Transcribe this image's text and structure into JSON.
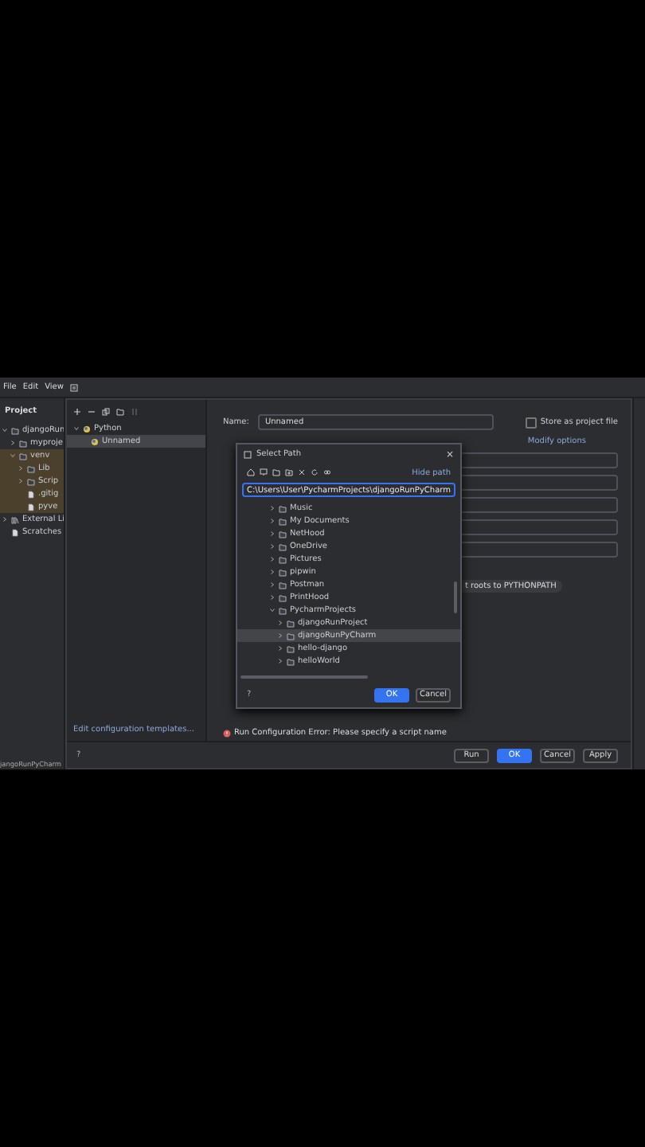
{
  "menu": [
    "File",
    "Edit",
    "View"
  ],
  "project": {
    "title": "Project",
    "tree": [
      {
        "label": "djangoRun",
        "expanded": true,
        "highlighted": false,
        "children": [
          {
            "label": "myproje",
            "expanded": false,
            "highlighted": false
          },
          {
            "label": "venv",
            "expanded": true,
            "highlighted": true,
            "children": [
              {
                "label": "Lib",
                "expanded": false,
                "highlighted": true
              },
              {
                "label": "Scrip",
                "expanded": false,
                "highlighted": true
              },
              {
                "label": ".gitig",
                "kind": "file",
                "highlighted": true
              },
              {
                "label": "pyve",
                "kind": "file",
                "highlighted": true
              }
            ]
          }
        ]
      },
      {
        "label": "External Li",
        "kind": "library",
        "expanded": false,
        "highlighted": false
      },
      {
        "label": "Scratches",
        "kind": "file",
        "highlighted": false
      }
    ]
  },
  "status_bar": {
    "text": "jangoRunPyCharm"
  },
  "run_config": {
    "tree": [
      {
        "label": "Python",
        "expanded": true,
        "selected": false,
        "children": [
          {
            "label": "Unnamed",
            "selected": true
          }
        ]
      }
    ],
    "help": "?",
    "templates_link": "Edit configuration templates...",
    "name_label": "Name:",
    "name_value": "Unnamed",
    "store_label": "Store as project file",
    "store_checked": false,
    "modify_options": "Modify options",
    "chip": "t roots to PYTHONPATH",
    "error": "Run Configuration Error: Please specify a script name",
    "buttons": [
      {
        "label": "Run",
        "primary": false
      },
      {
        "label": "OK",
        "primary": true
      },
      {
        "label": "Cancel",
        "primary": false
      },
      {
        "label": "Apply",
        "primary": false
      }
    ]
  },
  "select_path": {
    "title": "Select Path",
    "close": "×",
    "help": "?",
    "hide_path": "Hide path",
    "path": "C:\\Users\\User\\PycharmProjects\\djangoRunPyCharm",
    "tree": [
      {
        "label": "Music",
        "expanded": false,
        "selected": false
      },
      {
        "label": "My Documents",
        "expanded": false,
        "selected": false
      },
      {
        "label": "NetHood",
        "expanded": false,
        "selected": false
      },
      {
        "label": "OneDrive",
        "expanded": false,
        "selected": false
      },
      {
        "label": "Pictures",
        "expanded": false,
        "selected": false
      },
      {
        "label": "pipwin",
        "expanded": false,
        "selected": false
      },
      {
        "label": "Postman",
        "expanded": false,
        "selected": false
      },
      {
        "label": "PrintHood",
        "expanded": false,
        "selected": false
      },
      {
        "label": "PycharmProjects",
        "expanded": true,
        "selected": false,
        "children": [
          {
            "label": "djangoRunProject",
            "expanded": false,
            "selected": false
          },
          {
            "label": "djangoRunPyCharm",
            "expanded": false,
            "selected": true
          },
          {
            "label": "hello-django",
            "expanded": false,
            "selected": false
          },
          {
            "label": "helloWorld",
            "expanded": false,
            "selected": false
          }
        ]
      }
    ],
    "buttons": [
      {
        "label": "OK",
        "primary": true
      },
      {
        "label": "Cancel",
        "primary": false
      }
    ]
  }
}
